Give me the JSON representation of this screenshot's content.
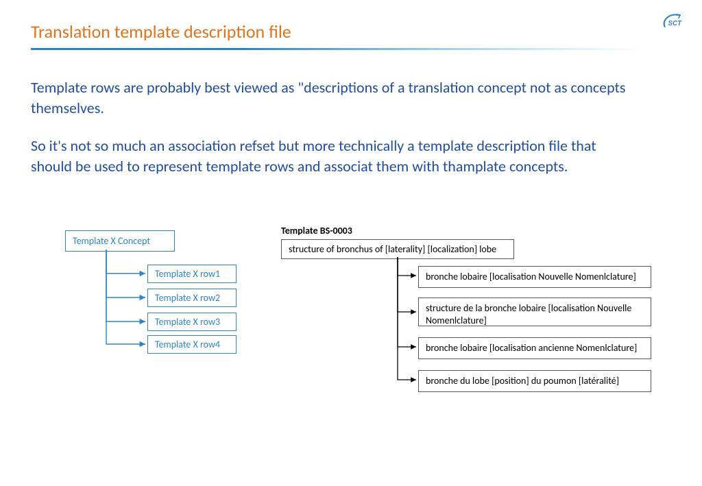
{
  "logo_text": "SCT",
  "title": "Translation template description file",
  "paragraph1": "Template rows are probably best viewed as \"descriptions of a translation concept not as concepts themselves.",
  "paragraph2": "So it's not so much an association refset but more technically  a template description file that should be used to represent template rows and associat them with thamplate concepts.",
  "left_diagram": {
    "concept": "Template X Concept",
    "rows": [
      "Template X row1",
      "Template X row2",
      "Template X row3",
      "Template X row4"
    ]
  },
  "right_diagram": {
    "header": "Template BS-0003",
    "root": "structure of bronchus of [laterality] [localization] lobe",
    "children": [
      "bronche lobaire [localisation Nouvelle Nomenlclature]",
      "structure de la bronche lobaire [localisation Nouvelle Nomenlclature]",
      "bronche lobaire [localisation ancienne Nomenlclature]",
      "bronche du lobe [position] du poumon [latéralité]"
    ]
  }
}
